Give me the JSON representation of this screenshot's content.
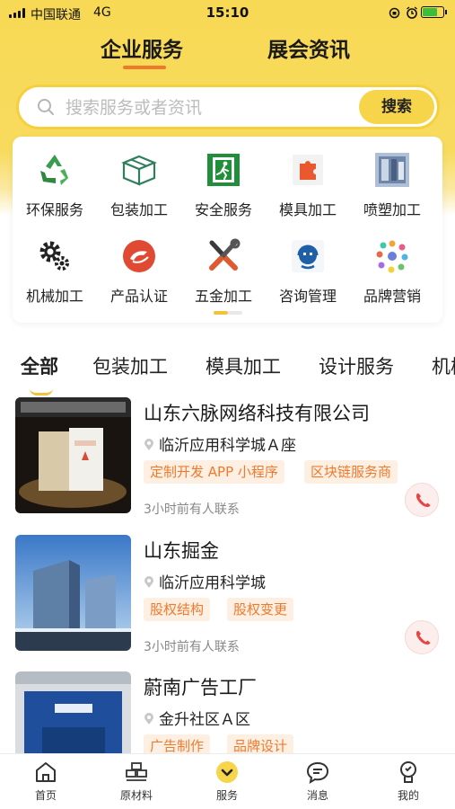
{
  "status_bar": {
    "carrier": "中国联通",
    "network": "4G",
    "time": "15:10"
  },
  "header": {
    "tabs": [
      {
        "label": "企业服务",
        "active": true
      },
      {
        "label": "展会资讯",
        "active": false
      }
    ]
  },
  "search": {
    "placeholder": "搜索服务或者资讯",
    "button_label": "搜索"
  },
  "services": [
    {
      "label": "环保服务",
      "icon": "recycle-icon"
    },
    {
      "label": "包装加工",
      "icon": "package-icon"
    },
    {
      "label": "安全服务",
      "icon": "safety-exit-icon"
    },
    {
      "label": "模具加工",
      "icon": "mold-puzzle-icon"
    },
    {
      "label": "喷塑加工",
      "icon": "spray-booth-icon"
    },
    {
      "label": "机械加工",
      "icon": "gears-icon"
    },
    {
      "label": "产品认证",
      "icon": "certification-icon"
    },
    {
      "label": "五金加工",
      "icon": "tools-icon"
    },
    {
      "label": "咨询管理",
      "icon": "consulting-icon"
    },
    {
      "label": "品牌营销",
      "icon": "brand-network-icon"
    }
  ],
  "category_tabs": [
    "全部",
    "包装加工",
    "模具加工",
    "设计服务",
    "机械"
  ],
  "listings": [
    {
      "title": "山东六脉网络科技有限公司",
      "location": "临沂应用科学城Ａ座",
      "tags": [
        "定制开发 APP 小程序",
        "区块链服务商"
      ],
      "contact": "3小时前有人联系"
    },
    {
      "title": "山东掘金",
      "location": "临沂应用科学城",
      "tags": [
        "股权结构",
        "股权变更"
      ],
      "contact": "3小时前有人联系"
    },
    {
      "title": "蔚南广告工厂",
      "location": "金升社区Ａ区",
      "tags": [
        "广告制作",
        "品牌设计"
      ],
      "contact": ""
    }
  ],
  "bottom_nav": [
    {
      "label": "首页",
      "icon": "home-icon"
    },
    {
      "label": "原材料",
      "icon": "materials-icon"
    },
    {
      "label": "服务",
      "icon": "service-icon",
      "active": true
    },
    {
      "label": "消息",
      "icon": "message-icon"
    },
    {
      "label": "我的",
      "icon": "profile-icon"
    }
  ],
  "colors": {
    "brand_yellow": "#f8d955",
    "accent_orange": "#ee7a2a",
    "tag_bg": "#fdf0e3",
    "phone_red": "#e54545"
  }
}
